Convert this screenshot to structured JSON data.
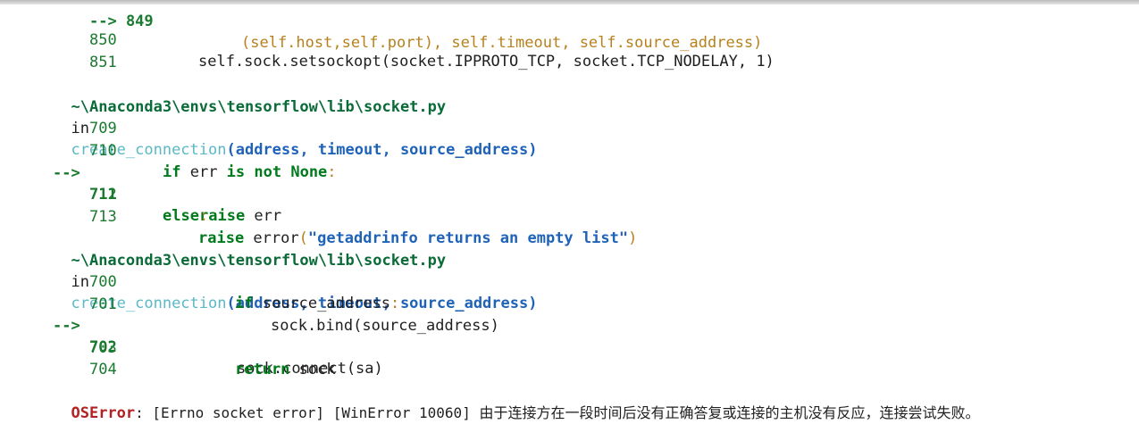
{
  "trace": {
    "frame0": {
      "cut_prefix": "--> 849",
      "cut_code": "(self.host,self.port), self.timeout, self.source_address)",
      "l850_num": "850",
      "l850_code": "self.sock.setsockopt(socket.IPPROTO_TCP, socket.TCP_NODELAY, 1)",
      "l851_num": "851"
    },
    "frame1": {
      "path": "~\\Anaconda3\\envs\\tensorflow\\lib\\socket.py",
      "in": "in",
      "func": "create_connection",
      "params": "(address, timeout, source_address)",
      "lines": [
        {
          "num": "709",
          "code": ""
        },
        {
          "num": "710",
          "kw1": "if",
          "plain1": " err ",
          "kw2": "is not",
          "plain2": " ",
          "kw3": "None",
          "punc": ":"
        },
        {
          "arrow": "-->",
          "num": "711",
          "kw": "raise",
          "plain": " err"
        },
        {
          "num": "712",
          "kw": "else",
          "punc": ":"
        },
        {
          "num": "713",
          "kw": "raise",
          "plain": " error",
          "p1": "(",
          "str": "\"getaddrinfo returns an empty list\"",
          "p2": ")"
        }
      ]
    },
    "frame2": {
      "path": "~\\Anaconda3\\envs\\tensorflow\\lib\\socket.py",
      "in": "in",
      "func": "create_connection",
      "params": "(address, timeout, source_address)",
      "lines": [
        {
          "num": "700",
          "kw": "if",
          "plain": " source_address",
          "punc": ":"
        },
        {
          "num": "701",
          "plain": "sock.bind(source_address)"
        },
        {
          "arrow": "-->",
          "num": "702",
          "plain": "sock.connect(sa)"
        },
        {
          "num": "703",
          "kw": "return",
          "plain": " sock"
        },
        {
          "num": "704"
        }
      ]
    },
    "error": {
      "name": "OSError",
      "message": ": [Errno socket error] [WinError 10060] 由于连接方在一段时间后没有正确答复或连接的主机没有反应，连接尝试失败。"
    }
  }
}
